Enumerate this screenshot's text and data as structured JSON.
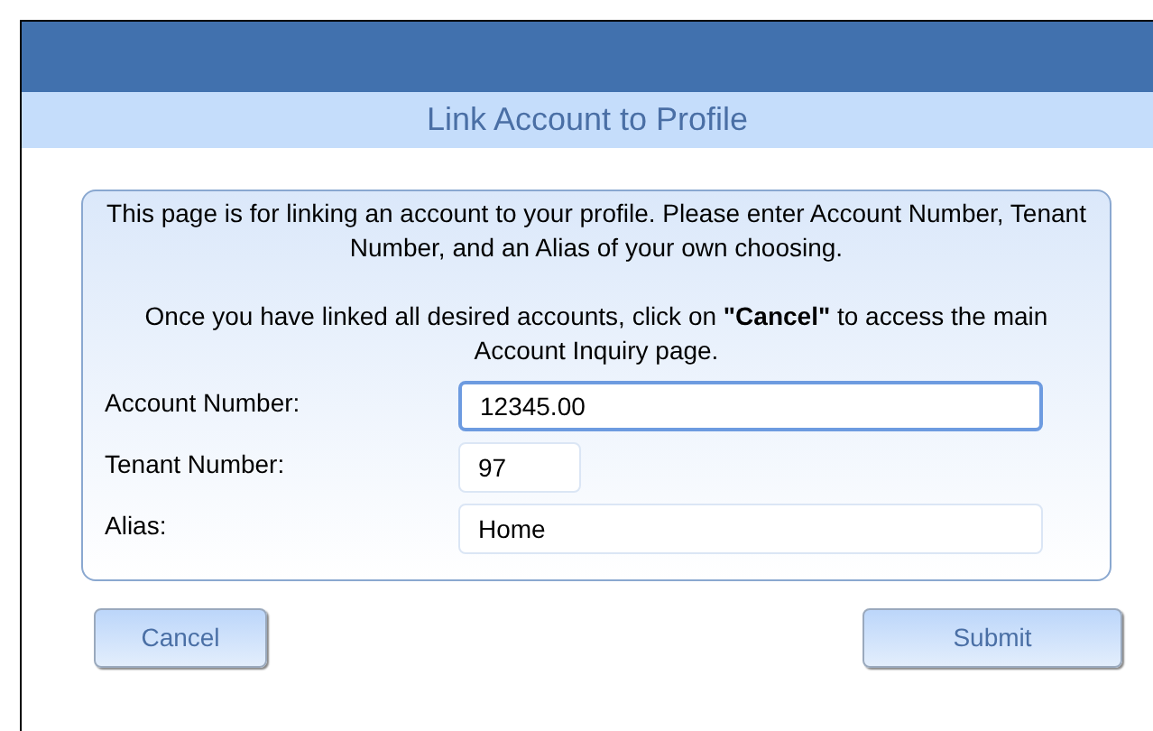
{
  "page": {
    "title": "Link Account to Profile"
  },
  "instructions": [
    "This page is for linking an account to your profile. Please enter Account Number, Tenant Number, and an Alias of your own choosing.",
    "Once you have linked all desired accounts, click on **\"Cancel\"** to access the main Account Inquiry page."
  ],
  "fields": [
    {
      "label": "Account Number:",
      "value": "12345.00",
      "focused": true,
      "kind": "wide"
    },
    {
      "label": "Tenant Number:",
      "value": "97",
      "focused": false,
      "kind": "short"
    },
    {
      "label": "Alias:",
      "value": "Home",
      "focused": false,
      "kind": "wide"
    }
  ],
  "buttons": [
    "Cancel",
    "Submit"
  ]
}
